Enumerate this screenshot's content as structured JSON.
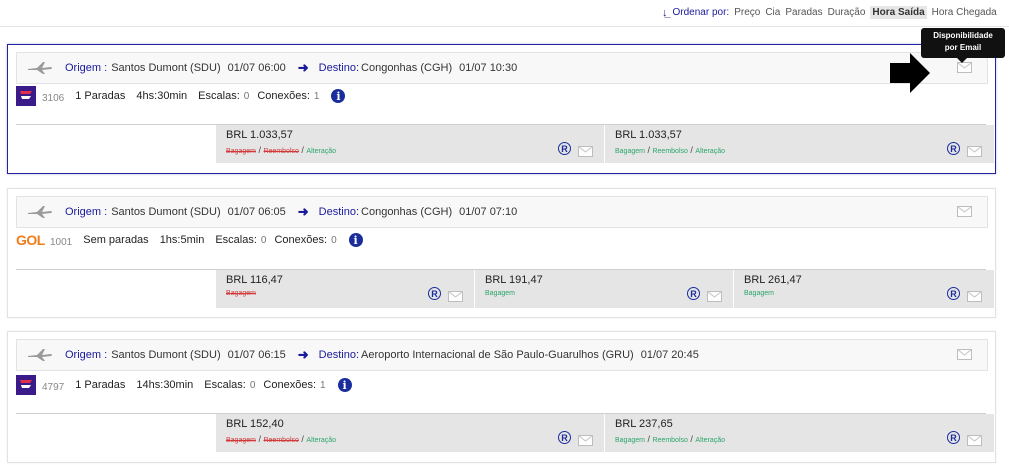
{
  "sort": {
    "label": "Ordenar por:",
    "options": [
      "Preço",
      "Cia",
      "Paradas",
      "Duração",
      "Hora Saída",
      "Hora Chegada"
    ],
    "active": "Hora Saída"
  },
  "tooltip": {
    "line1": "Disponibilidade",
    "line2": "por Email"
  },
  "flights": [
    {
      "origin_label": "Origem :",
      "origin": "Santos Dumont (SDU)",
      "dep_time": "01/07 06:00",
      "dest_label": "Destino:",
      "dest": "Congonhas (CGH)",
      "arr_time": "01/07 10:30",
      "airline_icon": "latam-logo",
      "flight_number": "3106",
      "stops": "1 Paradas",
      "duration": "4hs:30min",
      "escalas_label": "Escalas:",
      "escalas": "0",
      "conexoes_label": "Conexões:",
      "conexoes": "1",
      "fares": [
        {
          "price": "BRL 1.033,57",
          "tags": [
            {
              "t": "Bagagem",
              "s": "strike"
            },
            {
              "t": "Reembolso",
              "s": "strike"
            },
            {
              "t": "Alteração",
              "s": "ok"
            }
          ]
        },
        {
          "price": "BRL 1.033,57",
          "tags": [
            {
              "t": "Bagagem",
              "s": "ok"
            },
            {
              "t": "Reembolso",
              "s": "ok"
            },
            {
              "t": "Alteração",
              "s": "ok"
            }
          ]
        }
      ]
    },
    {
      "origin_label": "Origem :",
      "origin": "Santos Dumont (SDU)",
      "dep_time": "01/07 06:05",
      "dest_label": "Destino:",
      "dest": "Congonhas (CGH)",
      "arr_time": "01/07 07:10",
      "airline_icon": "gol-logo",
      "airline_text": "GOL",
      "flight_number": "1001",
      "stops": "Sem paradas",
      "duration": "1hs:5min",
      "escalas_label": "Escalas:",
      "escalas": "0",
      "conexoes_label": "Conexões:",
      "conexoes": "0",
      "fares": [
        {
          "price": "BRL 116,47",
          "tags": [
            {
              "t": "Bagagem",
              "s": "strike"
            }
          ]
        },
        {
          "price": "BRL 191,47",
          "tags": [
            {
              "t": "Bagagem",
              "s": "ok"
            }
          ]
        },
        {
          "price": "BRL 261,47",
          "tags": [
            {
              "t": "Bagagem",
              "s": "ok"
            }
          ]
        }
      ]
    },
    {
      "origin_label": "Origem :",
      "origin": "Santos Dumont (SDU)",
      "dep_time": "01/07 06:15",
      "dest_label": "Destino:",
      "dest": "Aeroporto Internacional de São Paulo-Guarulhos (GRU)",
      "arr_time": "01/07 20:45",
      "airline_icon": "latam-logo",
      "flight_number": "4797",
      "stops": "1 Paradas",
      "duration": "14hs:30min",
      "escalas_label": "Escalas:",
      "escalas": "0",
      "conexoes_label": "Conexões:",
      "conexoes": "1",
      "fares": [
        {
          "price": "BRL 152,40",
          "tags": [
            {
              "t": "Bagagem",
              "s": "strike"
            },
            {
              "t": "Reembolso",
              "s": "strike"
            },
            {
              "t": "Alteração",
              "s": "ok"
            }
          ]
        },
        {
          "price": "BRL 237,65",
          "tags": [
            {
              "t": "Bagagem",
              "s": "ok"
            },
            {
              "t": "Reembolso",
              "s": "ok"
            },
            {
              "t": "Alteração",
              "s": "ok"
            }
          ]
        }
      ]
    }
  ],
  "colors": {
    "brand_blue": "#1a1a9c",
    "strike_red": "#d23a3a",
    "ok_green": "#2aa66a",
    "latam_purple": "#3b1a8a",
    "latam_red": "#e2304a",
    "gol_orange": "#f07c1b"
  },
  "icons": [
    "sort-icon",
    "plane-icon",
    "arrow-right-icon",
    "mail-icon",
    "info-icon",
    "refund-badge-icon",
    "pointer-arrow-icon"
  ]
}
